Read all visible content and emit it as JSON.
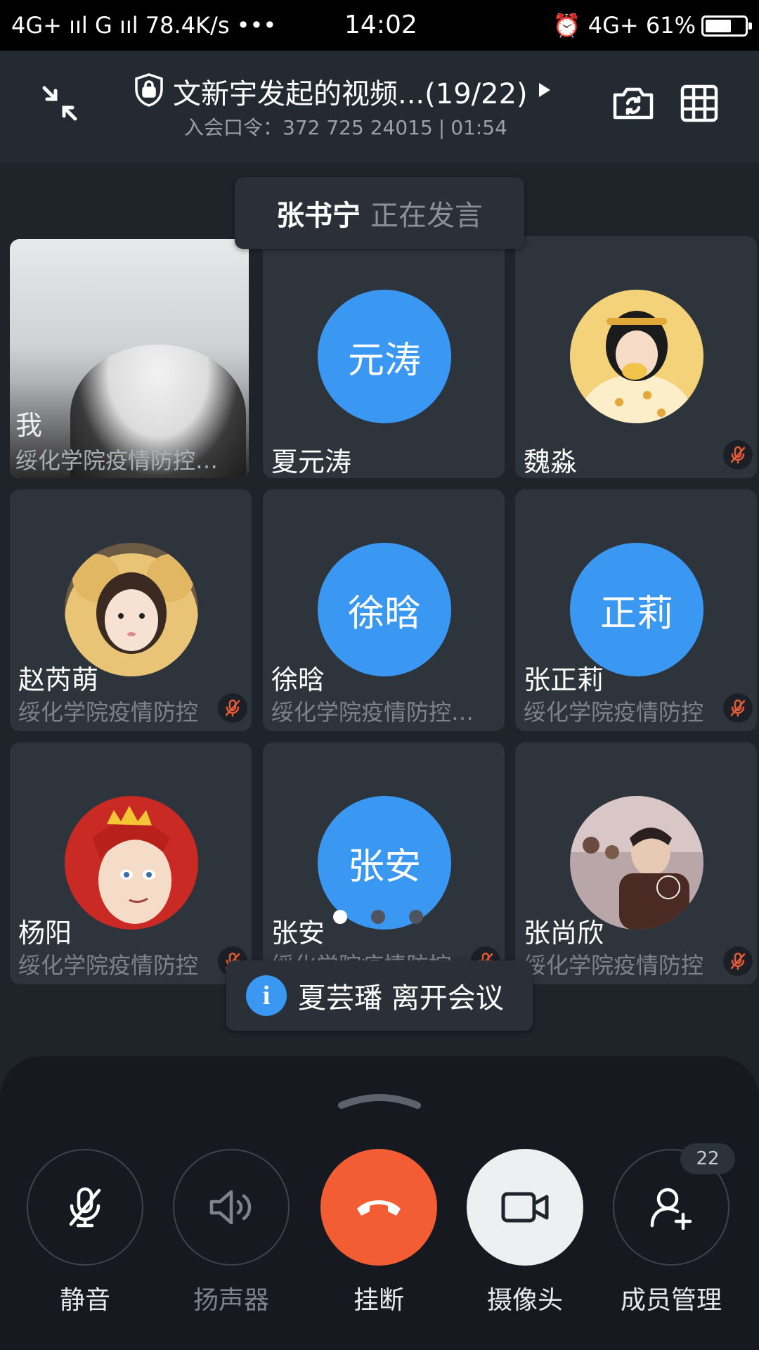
{
  "status_bar": {
    "left": "4G+ ııl G ııl 78.4K/s •••",
    "time": "14:02",
    "right": "⏰ 4G+ 61%"
  },
  "header": {
    "title": "文新宇发起的视频...(19/22)",
    "meeting_code_label": "入会口令：",
    "meeting_code": "372 725 24015",
    "elapsed": "01:54"
  },
  "speaking": {
    "name": "张书宁",
    "status": "正在发言"
  },
  "participants": [
    {
      "name": "我",
      "org": "绥化学院疫情防控…",
      "type": "video"
    },
    {
      "name": "夏元涛",
      "avatar_text": "元涛",
      "type": "initials"
    },
    {
      "name": "魏淼",
      "type": "photo",
      "muted": true
    },
    {
      "name": "赵芮萌",
      "org": "绥化学院疫情防控",
      "type": "photo",
      "muted": true
    },
    {
      "name": "徐晗",
      "avatar_text": "徐晗",
      "org": "绥化学院疫情防控…",
      "type": "initials"
    },
    {
      "name": "张正莉",
      "avatar_text": "正莉",
      "org": "绥化学院疫情防控",
      "type": "initials",
      "muted": true
    },
    {
      "name": "杨阳",
      "org": "绥化学院疫情防控",
      "type": "photo",
      "muted": true
    },
    {
      "name": "张安",
      "avatar_text": "张安",
      "org": "绥化学院疫情防控",
      "type": "initials",
      "muted": true
    },
    {
      "name": "张尚欣",
      "org": "绥化学院疫情防控",
      "type": "photo",
      "muted": true
    }
  ],
  "pagination": {
    "pages": 3,
    "current": 1
  },
  "toast": {
    "name": "夏芸璠",
    "message": "离开会议"
  },
  "controls": {
    "mute_label": "静音",
    "speaker_label": "扬声器",
    "hangup_label": "挂断",
    "camera_label": "摄像头",
    "members_label": "成员管理",
    "member_count": "22"
  },
  "colors": {
    "accent_blue": "#3a97f2",
    "hangup_orange": "#f25d33",
    "background": "#1f242b"
  }
}
